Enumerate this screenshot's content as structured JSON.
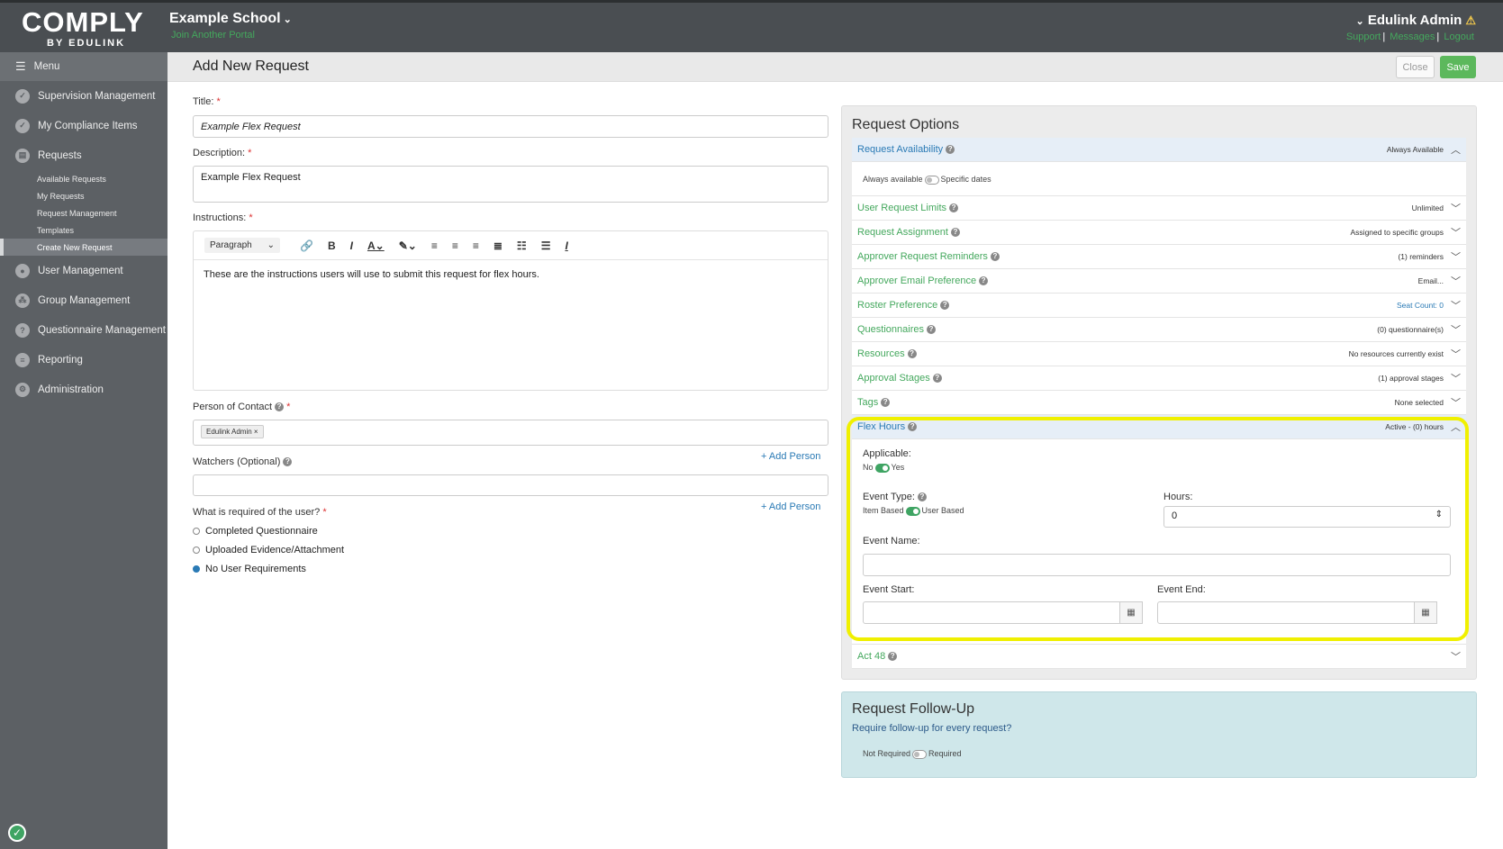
{
  "topbar": {
    "logo_main": "COMPLY",
    "logo_sub": "BY EDULINK",
    "school_name": "Example School",
    "join_link": "Join Another Portal",
    "admin_name": "Edulink Admin",
    "links": [
      "Support",
      "Messages",
      "Logout"
    ],
    "separator": "|"
  },
  "sidebar": {
    "menu_label": "Menu",
    "items": [
      {
        "label": "Supervision Management",
        "icon": "check-circle-icon"
      },
      {
        "label": "My Compliance Items",
        "icon": "check-circle-icon"
      },
      {
        "label": "Requests",
        "icon": "document-icon"
      }
    ],
    "sub_items": [
      "Available Requests",
      "My Requests",
      "Request Management",
      "Templates",
      "Create New Request"
    ],
    "items2": [
      {
        "label": "User Management",
        "icon": "user-icon"
      },
      {
        "label": "Group Management",
        "icon": "group-icon"
      },
      {
        "label": "Questionnaire Management",
        "icon": "question-icon"
      },
      {
        "label": "Reporting",
        "icon": "report-icon"
      },
      {
        "label": "Administration",
        "icon": "gear-icon"
      }
    ]
  },
  "header": {
    "title": "Add New Request",
    "close": "Close",
    "save": "Save"
  },
  "form": {
    "title_label": "Title:",
    "title_value": "Example Flex Request",
    "description_label": "Description:",
    "description_value": "Example Flex Request",
    "instructions_label": "Instructions:",
    "paragraph": "Paragraph",
    "instructions_text": "These are the instructions users will use to submit this request for flex hours.",
    "contact_label": "Person of Contact",
    "contact_tag": "Edulink Admin ×",
    "watchers_label": "Watchers (Optional)",
    "add_person": "+ Add Person",
    "required_label": "What is required of the user?",
    "options": [
      "Completed Questionnaire",
      "Uploaded Evidence/Attachment",
      "No User Requirements"
    ],
    "selected_option": 2,
    "required_mark": "*"
  },
  "request_options": {
    "heading": "Request Options",
    "availability": {
      "name": "Request Availability",
      "value": "Always Available",
      "left": "Always available",
      "right": "Specific dates"
    },
    "rows": [
      {
        "name": "User Request Limits",
        "value": "Unlimited"
      },
      {
        "name": "Request Assignment",
        "value": "Assigned to specific groups"
      },
      {
        "name": "Approver Request Reminders",
        "value": "(1) reminders"
      },
      {
        "name": "Approver Email Preference",
        "value": "Email..."
      },
      {
        "name": "Roster Preference",
        "value": "Seat Count: 0"
      },
      {
        "name": "Questionnaires",
        "value": "(0) questionnaire(s)"
      },
      {
        "name": "Resources",
        "value": "No resources currently exist"
      },
      {
        "name": "Approval Stages",
        "value": "(1) approval stages"
      },
      {
        "name": "Tags",
        "value": "None selected"
      }
    ],
    "flex": {
      "name": "Flex Hours",
      "value": "Active - (0) hours",
      "applicable_label": "Applicable:",
      "applicable_no": "No",
      "applicable_yes": "Yes",
      "event_type_label": "Event Type:",
      "event_type_left": "Item Based",
      "event_type_right": "User Based",
      "hours_label": "Hours:",
      "hours_value": "0",
      "event_name_label": "Event Name:",
      "event_start_label": "Event Start:",
      "event_end_label": "Event End:"
    },
    "act48": {
      "name": "Act 48"
    }
  },
  "followup": {
    "heading": "Request Follow-Up",
    "question": "Require follow-up for every request?",
    "left": "Not Required",
    "right": "Required"
  },
  "colors": {
    "accent_green": "#44a85d",
    "link_blue": "#2a7ab5",
    "highlight": "#f0f000"
  }
}
